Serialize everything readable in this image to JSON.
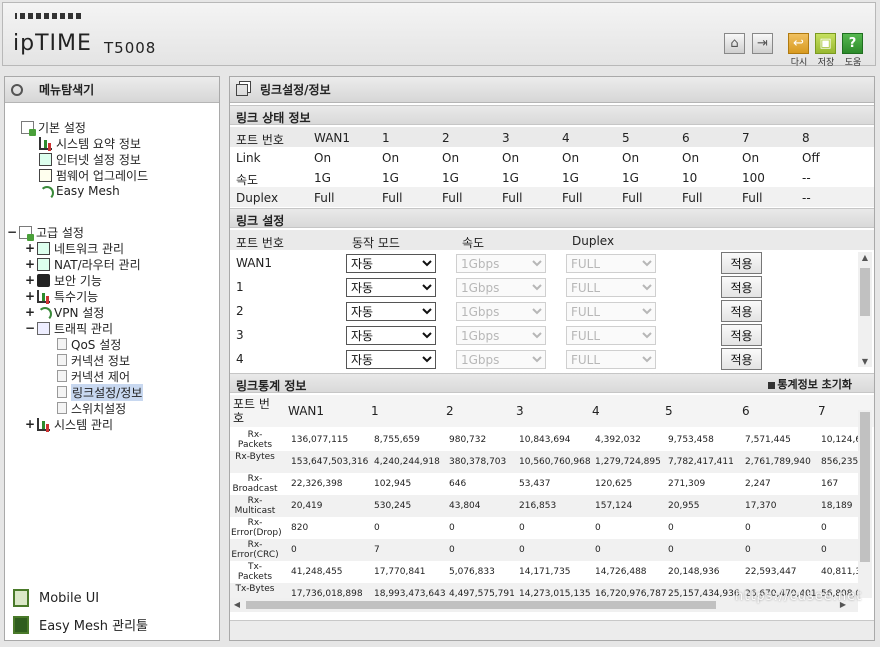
{
  "header": {
    "brand": "ipTIME",
    "model": "T5008",
    "buttons": [
      {
        "name": "home-icon",
        "label": ""
      },
      {
        "name": "logout-icon",
        "label": ""
      },
      {
        "name": "reload-icon",
        "label": "다시"
      },
      {
        "name": "save-icon",
        "label": "저장"
      },
      {
        "name": "help-icon",
        "label": "도움"
      }
    ]
  },
  "menu": {
    "title": "메뉴탐색기",
    "basic": {
      "label": "기본 설정",
      "items": [
        "시스템 요약 정보",
        "인터넷 설정 정보",
        "펌웨어 업그레이드",
        "Easy Mesh"
      ]
    },
    "advanced": {
      "label": "고급 설정",
      "items": [
        "네트워크 관리",
        "NAT/라우터 관리",
        "보안 기능",
        "특수기능",
        "VPN 설정",
        "트래픽 관리"
      ],
      "traffic_sub": [
        "QoS 설정",
        "커넥션 정보",
        "커넥션 제어",
        "링크설정/정보",
        "스위치설정"
      ],
      "system": "시스템 관리"
    },
    "mobile_ui": "Mobile UI",
    "mesh_tool": "Easy Mesh 관리툴"
  },
  "main": {
    "title": "링크설정/정보",
    "link_status": {
      "title": "링크 상태 정보",
      "ports": [
        "포트 번호",
        "WAN1",
        "1",
        "2",
        "3",
        "4",
        "5",
        "6",
        "7",
        "8"
      ],
      "rows": [
        {
          "label": "Link",
          "values": [
            "On",
            "On",
            "On",
            "On",
            "On",
            "On",
            "On",
            "On",
            "Off"
          ]
        },
        {
          "label": "속도",
          "values": [
            "1G",
            "1G",
            "1G",
            "1G",
            "1G",
            "1G",
            "10",
            "100",
            "--"
          ]
        },
        {
          "label": "Duplex",
          "values": [
            "Full",
            "Full",
            "Full",
            "Full",
            "Full",
            "Full",
            "Full",
            "Full",
            "--"
          ]
        }
      ]
    },
    "link_config": {
      "title": "링크 설정",
      "headers": [
        "포트 번호",
        "동작 모드",
        "속도",
        "Duplex"
      ],
      "rows": [
        {
          "port": "WAN1",
          "mode": "자동",
          "speed": "1Gbps",
          "duplex": "FULL"
        },
        {
          "port": "1",
          "mode": "자동",
          "speed": "1Gbps",
          "duplex": "FULL"
        },
        {
          "port": "2",
          "mode": "자동",
          "speed": "1Gbps",
          "duplex": "FULL"
        },
        {
          "port": "3",
          "mode": "자동",
          "speed": "1Gbps",
          "duplex": "FULL"
        },
        {
          "port": "4",
          "mode": "자동",
          "speed": "1Gbps",
          "duplex": "FULL"
        }
      ],
      "apply_label": "적용"
    },
    "link_stats": {
      "title": "링크통계 정보",
      "reset_label": "통계정보 초기화",
      "port_header": "포트 번호",
      "ports": [
        "WAN1",
        "1",
        "2",
        "3",
        "4",
        "5",
        "6",
        "7"
      ],
      "rows": [
        {
          "label": "Rx-Packets",
          "values": [
            "136,077,115",
            "8,755,659",
            "980,732",
            "10,843,694",
            "4,392,032",
            "9,753,458",
            "7,571,445",
            "10,124,6"
          ]
        },
        {
          "label": "Rx-Bytes",
          "values": [
            "153,647,503,316",
            "4,240,244,918",
            "380,378,703",
            "10,560,760,968",
            "1,279,724,895",
            "7,782,417,411",
            "2,761,789,940",
            "856,235"
          ]
        },
        {
          "label": "Rx-Broadcast",
          "values": [
            "22,326,398",
            "102,945",
            "646",
            "53,437",
            "120,625",
            "271,309",
            "2,247",
            "167"
          ]
        },
        {
          "label": "Rx-Multicast",
          "values": [
            "20,419",
            "530,245",
            "43,804",
            "216,853",
            "157,124",
            "20,955",
            "17,370",
            "18,189"
          ]
        },
        {
          "label": "Rx-Error(Drop)",
          "values": [
            "820",
            "0",
            "0",
            "0",
            "0",
            "0",
            "0",
            "0"
          ]
        },
        {
          "label": "Rx-Error(CRC)",
          "values": [
            "0",
            "7",
            "0",
            "0",
            "0",
            "0",
            "0",
            "0"
          ]
        },
        {
          "label": "Tx-Packets",
          "values": [
            "41,248,455",
            "17,770,841",
            "5,076,833",
            "14,171,735",
            "14,726,488",
            "20,148,936",
            "22,593,447",
            "40,811,3"
          ]
        },
        {
          "label": "Tx-Bytes",
          "values": [
            "17,736,018,898",
            "18,993,473,643",
            "4,497,575,791",
            "14,273,015,135",
            "16,720,976,787",
            "25,157,434,936",
            "26,670,470,401",
            "56,808,6"
          ]
        }
      ]
    },
    "watermark": "https://cusee.net"
  }
}
